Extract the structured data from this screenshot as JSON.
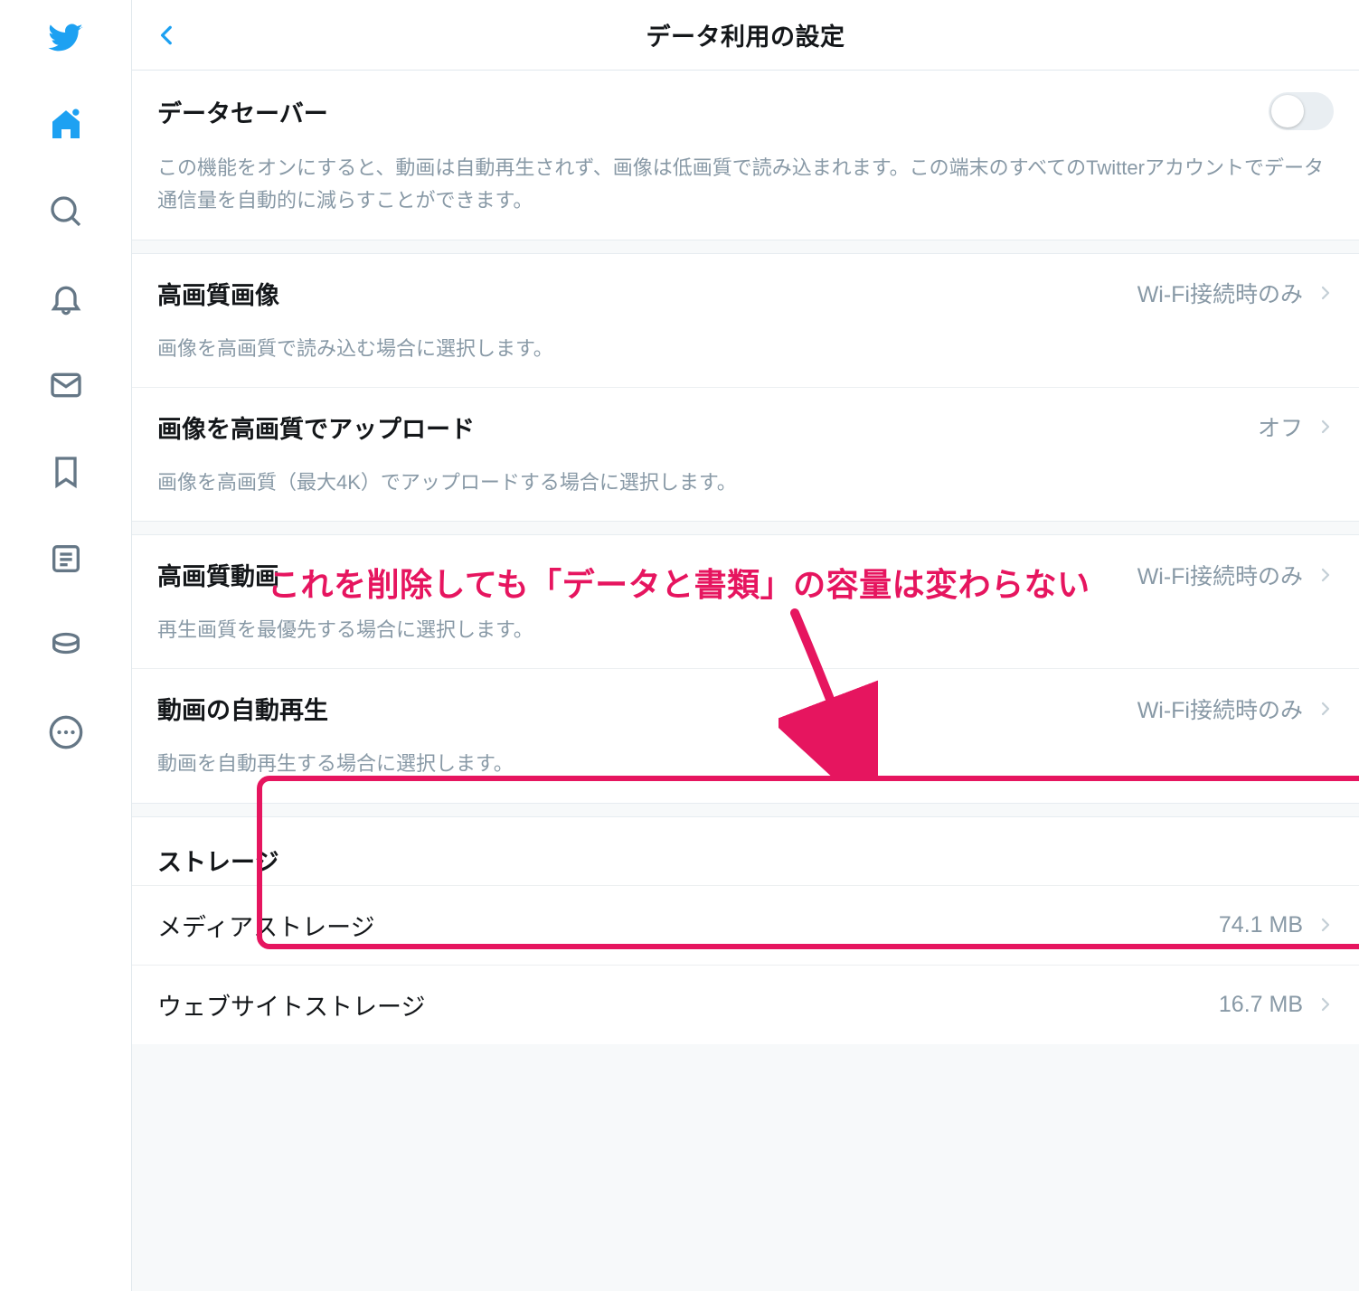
{
  "header": {
    "title": "データ利用の設定"
  },
  "dataSaver": {
    "label": "データセーバー",
    "description": "この機能をオンにすると、動画は自動再生されず、画像は低画質で読み込まれます。この端末のすべてのTwitterアカウントでデータ通信量を自動的に減らすことができます。",
    "enabled": false
  },
  "imageQuality": {
    "high": {
      "label": "高画質画像",
      "value": "Wi-Fi接続時のみ",
      "description": "画像を高画質で読み込む場合に選択します。"
    },
    "upload": {
      "label": "画像を高画質でアップロード",
      "value": "オフ",
      "description": "画像を高画質（最大4K）でアップロードする場合に選択します。"
    }
  },
  "video": {
    "high": {
      "label": "高画質動画",
      "value": "Wi-Fi接続時のみ",
      "description": "再生画質を最優先する場合に選択します。"
    },
    "autoplay": {
      "label": "動画の自動再生",
      "value": "Wi-Fi接続時のみ",
      "description": "動画を自動再生する場合に選択します。"
    }
  },
  "storage": {
    "header": "ストレージ",
    "media": {
      "label": "メディアストレージ",
      "value": "74.1 MB"
    },
    "web": {
      "label": "ウェブサイトストレージ",
      "value": "16.7 MB"
    }
  },
  "annotation": {
    "text": "これを削除しても「データと書類」の容量は変わらない",
    "color": "#e6155f"
  }
}
